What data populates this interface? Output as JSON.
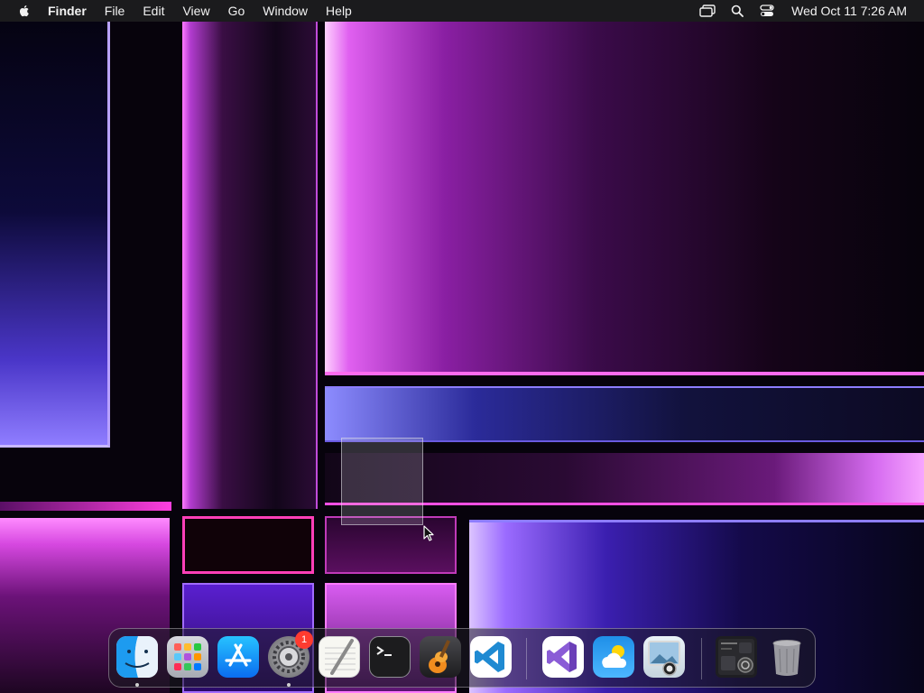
{
  "menubar": {
    "apple_icon": "apple-logo-icon",
    "app_name": "Finder",
    "items": [
      "File",
      "Edit",
      "View",
      "Go",
      "Window",
      "Help"
    ],
    "status_icons": [
      "screen-mirroring-icon",
      "spotlight-search-icon",
      "control-center-icon"
    ],
    "clock": "Wed Oct 11  7:26 AM"
  },
  "dock": {
    "apps": [
      {
        "name": "Finder",
        "icon": "finder-icon",
        "running": true
      },
      {
        "name": "Launchpad",
        "icon": "launchpad-icon"
      },
      {
        "name": "App Store",
        "icon": "app-store-icon"
      },
      {
        "name": "System Settings",
        "icon": "system-settings-icon",
        "badge": "1",
        "running": true
      },
      {
        "name": "TextEdit",
        "icon": "textedit-icon"
      },
      {
        "name": "Terminal",
        "icon": "terminal-icon"
      },
      {
        "name": "GarageBand",
        "icon": "garageband-icon"
      },
      {
        "name": "Visual Studio Code",
        "icon": "vscode-icon"
      },
      {
        "name": "Visual Studio",
        "icon": "visual-studio-icon"
      },
      {
        "name": "Weather",
        "icon": "weather-icon"
      },
      {
        "name": "Preview",
        "icon": "preview-icon"
      },
      {
        "name": "Downloads Stack",
        "icon": "downloads-stack-icon"
      },
      {
        "name": "Trash",
        "icon": "trash-icon"
      }
    ]
  },
  "colors": {
    "menubar_bg": "#1b1b1d",
    "badge": "#ff3b30",
    "vscode_blue": "#1f8ad2",
    "visual_studio_purple": "#8a5cd6"
  }
}
